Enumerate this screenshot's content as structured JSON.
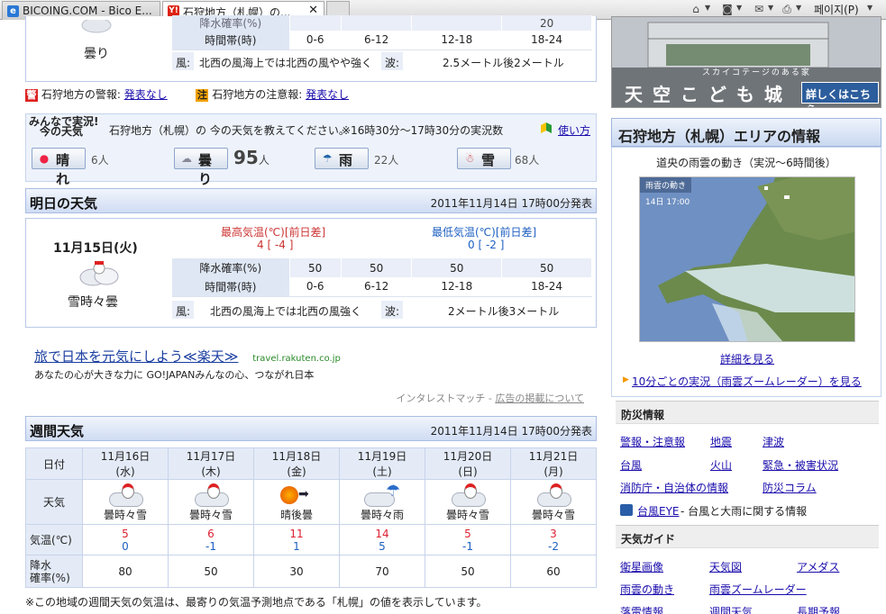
{
  "browser": {
    "tabs": [
      {
        "label": "BICOING.COM - Bico E...",
        "active": false
      },
      {
        "label": "石狩地方（札幌）の...",
        "active": true,
        "close": "✕"
      }
    ],
    "page_menu": "페이지(P)"
  },
  "today_tail": {
    "weather": "曇り",
    "precip_label_partial": "降水確率(%)",
    "precip_value_partial": "20",
    "time_label": "時間帯(時)",
    "time_slots": [
      "0-6",
      "6-12",
      "12-18",
      "18-24"
    ],
    "wind_label": "風:",
    "wind_text": "北西の風海上では北西の風やや強く",
    "wave_label": "波:",
    "wave_text": "2.5メートル後2メートル"
  },
  "alerts": {
    "warn_badge": "警",
    "warn_label": "石狩地方の警報:",
    "warn_link": "発表なし",
    "caution_badge": "注",
    "caution_label": "石狩地方の注意報:",
    "caution_link": "発表なし"
  },
  "live": {
    "logo_line1": "みんなで実況!",
    "logo_line2": "今の天気",
    "prompt": "石狩地方（札幌）の 今の天気を教えてください。",
    "period": "※16時30分～17時30分の実況数",
    "howto": "使い方",
    "votes": [
      {
        "label": "晴れ",
        "count": "6",
        "unit": "人"
      },
      {
        "label": "曇り",
        "count": "95",
        "unit": "人"
      },
      {
        "label": "雨",
        "count": "22",
        "unit": "人"
      },
      {
        "label": "雪",
        "count": "68",
        "unit": "人"
      }
    ]
  },
  "tomorrow": {
    "title": "明日の天気",
    "issued": "2011年11月14日 17時00分発表",
    "date": "11月15日(火)",
    "weather": "雪時々曇",
    "max_label": "最高気温(℃)[前日差]",
    "max_value": "4 [ -4 ]",
    "min_label": "最低気温(℃)[前日差]",
    "min_value": "0 [ -2 ]",
    "precip_label": "降水確率(%)",
    "precip": [
      "50",
      "50",
      "50",
      "50"
    ],
    "time_label": "時間帯(時)",
    "time_slots": [
      "0-6",
      "6-12",
      "12-18",
      "18-24"
    ],
    "wind_label": "風:",
    "wind_text": "北西の風海上では北西の風強く",
    "wave_label": "波:",
    "wave_text": "2メートル後3メートル"
  },
  "ad": {
    "headline": "旅で日本を元気にしよう≪楽天≫",
    "domain": "travel.rakuten.co.jp",
    "body": "あなたの心が大きな力に GO!JAPANみんなの心、つながれ日本",
    "footer_prefix": "インタレストマッチ - ",
    "footer_link": "広告の掲載について"
  },
  "weekly": {
    "title": "週間天気",
    "issued": "2011年11月14日 17時00分発表",
    "row_date": "日付",
    "row_weather": "天気",
    "row_temp": "気温(℃)",
    "row_precip_1": "降水",
    "row_precip_2": "確率(%)",
    "days": [
      {
        "date": "11月16日",
        "dow": "(水)",
        "weather": "曇時々雪",
        "hi": "5",
        "lo": "0",
        "pop": "80"
      },
      {
        "date": "11月17日",
        "dow": "(木)",
        "weather": "曇時々雪",
        "hi": "6",
        "lo": "-1",
        "pop": "50"
      },
      {
        "date": "11月18日",
        "dow": "(金)",
        "weather": "晴後曇",
        "hi": "11",
        "lo": "1",
        "pop": "30"
      },
      {
        "date": "11月19日",
        "dow": "(土)",
        "weather": "曇時々雨",
        "hi": "14",
        "lo": "5",
        "pop": "70"
      },
      {
        "date": "11月20日",
        "dow": "(日)",
        "weather": "曇時々雪",
        "hi": "5",
        "lo": "-1",
        "pop": "50"
      },
      {
        "date": "11月21日",
        "dow": "(月)",
        "weather": "曇時々雪",
        "hi": "3",
        "lo": "-2",
        "pop": "60"
      }
    ],
    "note": "※この地域の週間天気の気温は、最寄りの気温予測地点である「札幌」の値を表示しています。"
  },
  "banner": {
    "tagline": "スカイコテージのある家",
    "title": "天 空 こ ど も 城",
    "button": "詳しくはこちら"
  },
  "side": {
    "area_title": "石狩地方（札幌）エリアの情報",
    "radar_caption": "道央の雨雲の動き（実況～6時間後）",
    "radar_label": "雨雲の動き",
    "radar_time": "14日 17:00",
    "radar_more": "詳細を見る",
    "radar_zoom": "10分ごとの実況（雨雲ズームレーダー）を見る",
    "disaster_title": "防災情報",
    "disaster_links": [
      "警報・注意報",
      "地震",
      "津波",
      "台風",
      "火山",
      "緊急・被害状況",
      "消防庁・自治体の情報",
      "防災コラム"
    ],
    "typhoon_eye": "台風EYE",
    "typhoon_eye_desc": " - 台風と大雨に関する情報",
    "guide_title": "天気ガイド",
    "guide_links": [
      "衛星画像",
      "天気図",
      "アメダス",
      "雨雲の動き",
      "雨雲ズームレーダー",
      "落雷情報",
      "週間天気",
      "長期予報"
    ]
  }
}
